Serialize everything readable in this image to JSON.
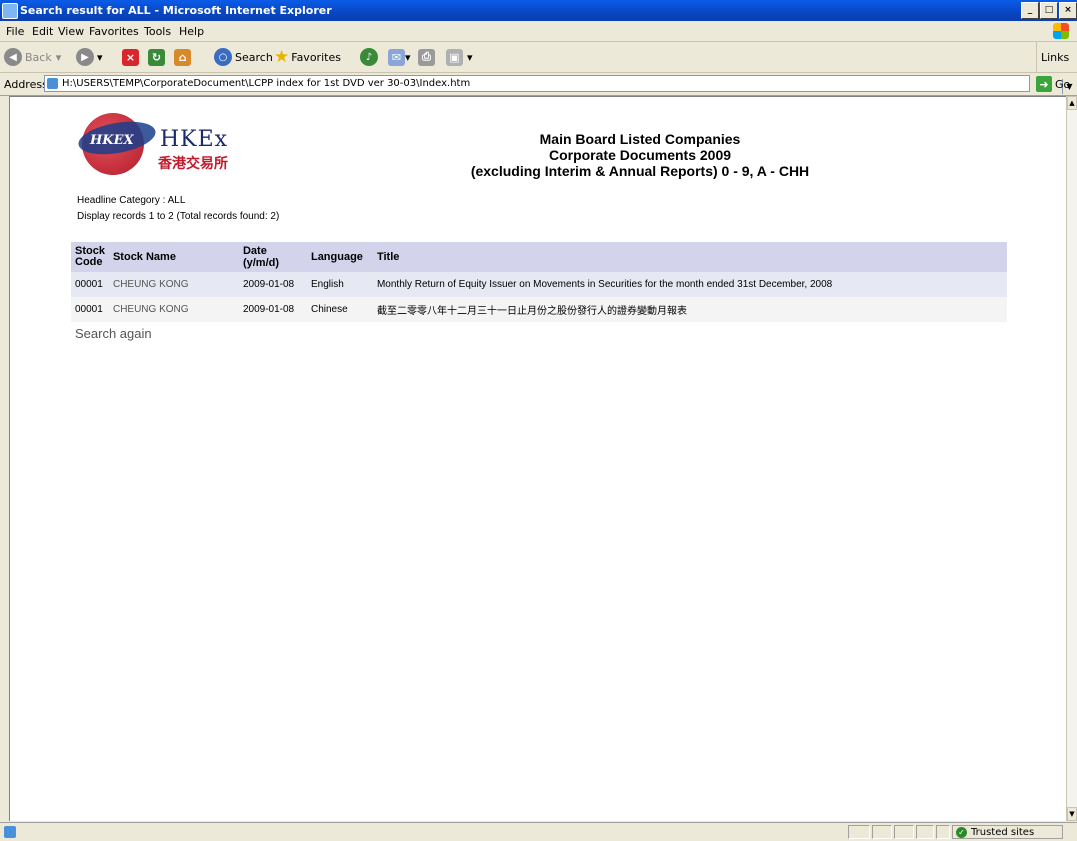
{
  "window": {
    "title": "Search result for ALL - Microsoft Internet Explorer"
  },
  "menu": [
    "File",
    "Edit",
    "View",
    "Favorites",
    "Tools",
    "Help"
  ],
  "toolbar": {
    "back": "Back",
    "search": "Search",
    "favorites": "Favorites",
    "links": "Links"
  },
  "address": {
    "label": "Address",
    "url": "H:\\USERS\\TEMP\\CorporateDocument\\LCPP index for 1st DVD ver 30-03\\Index.htm",
    "go": "Go"
  },
  "logo": {
    "en": "HKEx",
    "zh": "香港交易所",
    "mark": "HKEX"
  },
  "page": {
    "heading_lines": [
      "Main Board Listed Companies",
      "Corporate Documents 2009",
      "(excluding Interim & Annual Reports) 0 - 9, A - CHH"
    ],
    "headline_category": "Headline Category : ALL",
    "display_records": "Display records 1 to 2 (Total records found: 2)",
    "search_again": "Search again"
  },
  "table": {
    "headers": {
      "code": "Stock Code",
      "name": "Stock Name",
      "date": "Date (y/m/d)",
      "language": "Language",
      "title": "Title"
    },
    "rows": [
      {
        "code": "00001",
        "name": "CHEUNG KONG",
        "date": "2009-01-08",
        "language": "English",
        "title": "Monthly Return of Equity Issuer on Movements in Securities for the month ended 31st December, 2008"
      },
      {
        "code": "00001",
        "name": "CHEUNG KONG",
        "date": "2009-01-08",
        "language": "Chinese",
        "title": "截至二零零八年十二月三十一日止月份之股份發行人的證券變動月報表"
      }
    ]
  },
  "status": {
    "zone": "Trusted sites"
  }
}
